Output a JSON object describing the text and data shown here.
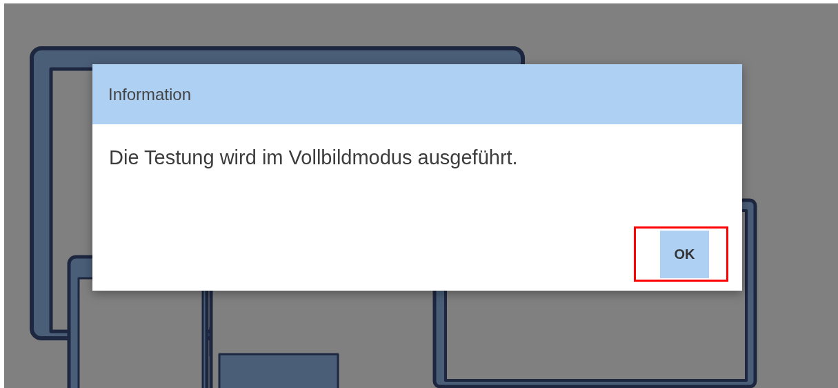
{
  "dialog": {
    "title": "Information",
    "message": "Die Testung wird im Vollbildmodus ausgeführt.",
    "buttons": [
      {
        "label": "OK",
        "highlighted": true
      }
    ]
  }
}
